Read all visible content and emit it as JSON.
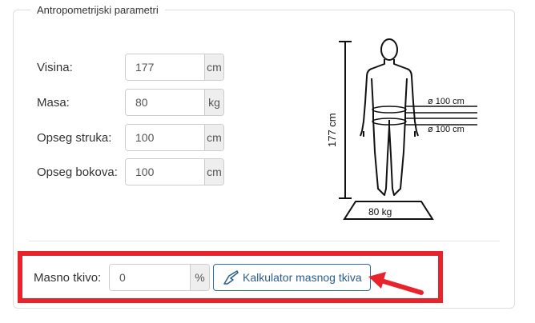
{
  "section": {
    "legend": "Antropometrijski parametri"
  },
  "fields": [
    {
      "label": "Visina:",
      "value": "177",
      "unit": "cm"
    },
    {
      "label": "Masa:",
      "value": "80",
      "unit": "kg"
    },
    {
      "label": "Opseg struka:",
      "value": "100",
      "unit": "cm"
    },
    {
      "label": "Opseg bokova:",
      "value": "100",
      "unit": "cm"
    }
  ],
  "body_figure": {
    "height_label": "177 cm",
    "waist_label": "ø 100 cm",
    "hip_label": "ø 100 cm",
    "weight_label": "80 kg"
  },
  "fat": {
    "label": "Masno tkivo:",
    "value": "0",
    "unit": "%",
    "button_label": "Kalkulator masnog tkiva"
  },
  "colors": {
    "highlight": "#e8232b",
    "button_border": "#2e6da4",
    "button_text": "#2a5d8f"
  }
}
